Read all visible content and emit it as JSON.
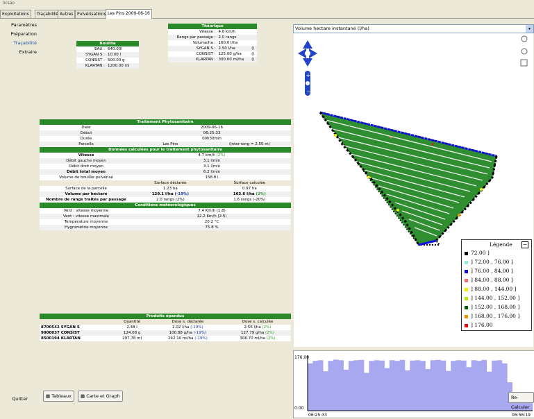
{
  "app": {
    "title": "licsao"
  },
  "tabs": [
    "Exploitations",
    "Traçabilité",
    "Autres",
    "Pulvérisations",
    "Les Pins 2009-06-16"
  ],
  "nav": [
    "Paramètres",
    "Préparation",
    "Traçabilité",
    "Extraire",
    "Quitter"
  ],
  "bouillie": {
    "title": "Bouillie",
    "rows": [
      [
        "EAU :",
        "640.00l"
      ],
      [
        "SYGAN S :",
        "10.00 l"
      ],
      [
        "CONSIST :",
        "500.00 g"
      ],
      [
        "KLARTAN :",
        "1200.00 ml"
      ]
    ]
  },
  "theorique": {
    "title": "Théorique",
    "rows": [
      [
        "Vitesse :",
        "4.6 km/h",
        ""
      ],
      [
        "Rangs par passage :",
        "2.0 rangs",
        ""
      ],
      [
        "Volume/ha :",
        "160.0 l/ha",
        ""
      ],
      [
        "SYGAN S :",
        "2.50 l/ha",
        "()"
      ],
      [
        "CONSIST :",
        "125.00 g/ha",
        "()"
      ],
      [
        "KLARTAN :",
        "300.00 ml/ha",
        "()"
      ]
    ]
  },
  "traitement": {
    "title": "Traitement Phytosanitaire",
    "rows": [
      [
        "Date",
        "2009-06-16"
      ],
      [
        "Début",
        "06:25:33"
      ],
      [
        "Durée",
        "00h30min"
      ]
    ],
    "parcelle": [
      "Parcelle",
      "Les Pins",
      "(inter-rang = 2.50 m)"
    ],
    "calc_title": "Données calculées pour le traitement phytosanitaire",
    "vitesse": [
      "Vitesse",
      "4.7 km/h",
      "(2%)"
    ],
    "debits": [
      [
        "Débit gauche moyen",
        "3.1 l/min"
      ],
      [
        "Débit droit moyen",
        "3.1 l/min"
      ],
      [
        "Débit total moyen",
        "6.2 l/min"
      ],
      [
        "Volume de bouillie pulvérisé",
        "158.8 l"
      ]
    ],
    "col_decl": "Surface déclarée",
    "col_calc": "Surface calculée",
    "surface": [
      "Surface de la parcelle",
      "1.23 ha",
      "0.97 ha"
    ],
    "volume": [
      "Volume par hectare",
      "129.1 l/ha",
      "(-19%)",
      "163.6 l/ha",
      "(2%)"
    ],
    "rangs": [
      "Nombre de rangs traités par passage",
      "2.0 rangs (2%)",
      "1.6 rangs (-20%)"
    ]
  },
  "meteo": {
    "title": "Conditions météorologiques",
    "rows": [
      [
        "Vent : vitesse moyenne",
        "7.4 Km/h (1.8)"
      ],
      [
        "Vent : vitesse maximale",
        "12.2 Km/h (2.5)"
      ],
      [
        "Temperature moyenne",
        "20.2 °C"
      ],
      [
        "Hygrométrie moyenne",
        "75.8 %"
      ]
    ]
  },
  "produits": {
    "title": "Produits épandus",
    "headers": [
      "",
      "Quantité",
      "Dose s. déclarée",
      "Dose s. calculée"
    ],
    "rows": [
      [
        "8700542 SYGAN S",
        "2.48 l",
        "2.02 l/ha",
        "(-19%)",
        "2.56 l/ha",
        "(2%)"
      ],
      [
        "9900037 CONSIST",
        "124.08 g",
        "100.88 g/ha",
        "(-19%)",
        "127.79 g/ha",
        "(2%)"
      ],
      [
        "8500194 KLARTAN",
        "297.78 ml",
        "242.10 ml/ha",
        "(-19%)",
        "306.70 ml/ha",
        "(2%)"
      ]
    ]
  },
  "buttons": {
    "tableaux": "Tableaux",
    "carte": "Carte et Graph",
    "recalc": "Re-Calculer"
  },
  "map": {
    "dropdown": "Volume hectare instantané (l/ha)"
  },
  "legend": {
    "title": "Légende",
    "items": [
      {
        "label": "72.00 ]",
        "color": "#000000"
      },
      {
        "label": "] 72.00 ,  76.00 ]",
        "color": "#8ff0e0"
      },
      {
        "label": "] 76.00 ,  84.00 ]",
        "color": "#1010e0"
      },
      {
        "label": "] 84.00 ,  88.00 ]",
        "color": "#f07070"
      },
      {
        "label": "] 88.00 , 144.00 ]",
        "color": "#f0f000"
      },
      {
        "label": "] 144.00 , 152.00 ]",
        "color": "#b0f000"
      },
      {
        "label": "] 152.00 , 168.00 ]",
        "color": "#006000"
      },
      {
        "label": "] 168.00 , 176.00 ]",
        "color": "#f09000"
      },
      {
        "label": "] 176.00",
        "color": "#e01010"
      }
    ]
  },
  "chart_data": {
    "type": "area",
    "ylim": [
      0,
      176
    ],
    "y_ticks": [
      "176.00",
      "0.00"
    ],
    "x_ticks": [
      "06:25:33",
      "06:56:19"
    ],
    "values": [
      150,
      158,
      160,
      125,
      158,
      162,
      160,
      130,
      158,
      160,
      161,
      120,
      158,
      160,
      159,
      135,
      160,
      158,
      161,
      128,
      159,
      160,
      158,
      132,
      160,
      161,
      159,
      126,
      158,
      160,
      159,
      138,
      160,
      158,
      161,
      124,
      159,
      160,
      150,
      90,
      30,
      30,
      40,
      35
    ]
  }
}
